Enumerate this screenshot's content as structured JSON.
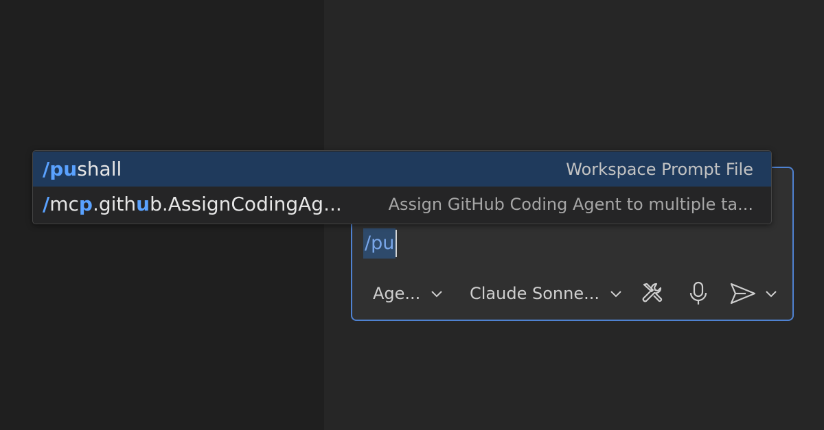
{
  "suggestions": [
    {
      "command_parts": [
        {
          "text": "/",
          "hl": true
        },
        {
          "text": "pu",
          "hl": true
        },
        {
          "text": "shall",
          "hl": false
        }
      ],
      "description": "Workspace Prompt File",
      "selected": true
    },
    {
      "command_parts": [
        {
          "text": "/",
          "hl": true
        },
        {
          "text": "mc",
          "hl": false
        },
        {
          "text": "p",
          "hl": true
        },
        {
          "text": ".gith",
          "hl": false
        },
        {
          "text": "u",
          "hl": true
        },
        {
          "text": "b.AssignCodingAg...",
          "hl": false
        }
      ],
      "description": "Assign GitHub Coding Agent to multiple ta...",
      "selected": false
    }
  ],
  "chat": {
    "input_value": "/pu",
    "mode_label": "Age...",
    "model_label": "Claude Sonne..."
  },
  "icons": {
    "mode_chevron": "chevron-down-icon",
    "model_chevron": "chevron-down-icon",
    "tools": "tools-icon",
    "mic": "microphone-icon",
    "send": "send-icon",
    "send_more": "chevron-down-icon"
  },
  "colors": {
    "accent": "#4f82d1",
    "highlight": "#5aa2ff",
    "selected_row": "#1f3a5c"
  }
}
